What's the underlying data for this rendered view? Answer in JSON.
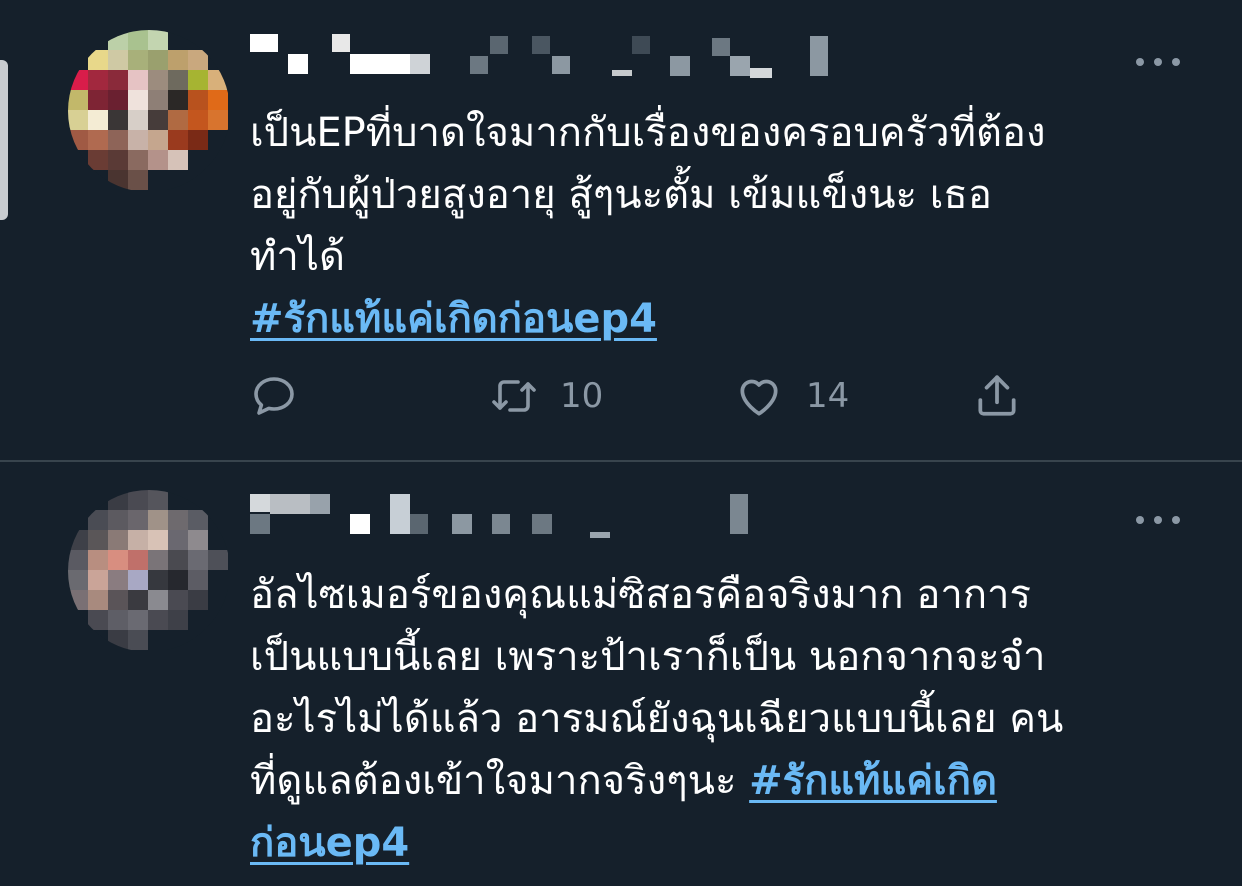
{
  "tweets": [
    {
      "body": "เป็นEPที่บาดใจมากกับเรื่องของครอบครัวที่ต้อง อยู่กับผู้ป่วยสูงอายุ สู้ๆนะตั้ม เข้มแข็งนะ เธอ ทำได้",
      "body_lines": [
        "เป็นEPที่บาดใจมากกับเรื่องของครอบครัวที่ต้อง",
        "อยู่กับผู้ป่วยสูงอายุ สู้ๆนะตั้ม เข้มแข็งนะ เธอ",
        "ทำได้"
      ],
      "hashtag": "#รักแท้แค่เกิดก่อนep4",
      "retweets": "10",
      "likes": "14"
    },
    {
      "body_lines": [
        "อัลไซเมอร์ของคุณแม่ซิสอรคือจริงมาก อาการ",
        "เป็นแบบนี้เลย เพราะป้าเราก็เป็น นอกจากจะจำ",
        "อะไรไม่ได้แล้ว อารมณ์ยังฉุนเฉียวแบบนี้เลย คน",
        "ที่ดูแลต้องเข้าใจมากจริงๆนะ "
      ],
      "hashtag_part1": "#รักแท้แค่เกิด",
      "hashtag_part2": "ก่อนep4"
    }
  ],
  "icons": {
    "reply": "reply-icon",
    "retweet": "retweet-icon",
    "like": "heart-icon",
    "share": "share-icon",
    "more": "more-icon"
  },
  "colors": {
    "background": "#15202b",
    "text": "#ffffff",
    "secondary": "#8b98a5",
    "link": "#6ab9f5",
    "divider": "#38444d"
  }
}
